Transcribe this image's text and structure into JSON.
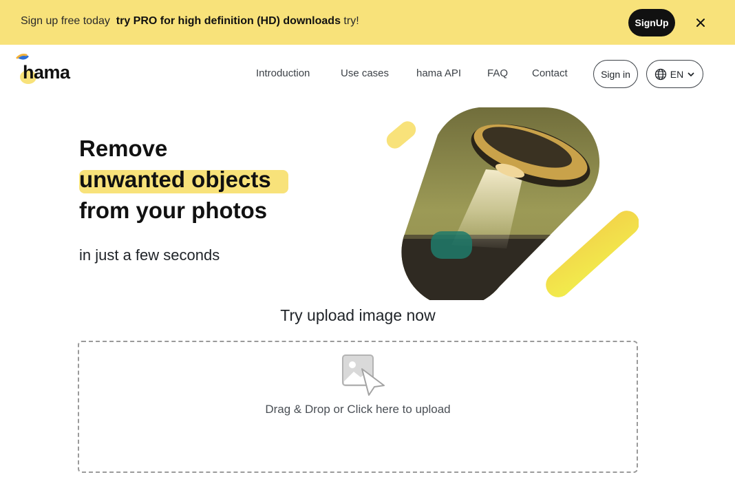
{
  "promo": {
    "text_before": "Sign up free today",
    "text_bold": "try PRO for high definition (HD) downloads",
    "text_after": "try!",
    "signup_label": "SignUp"
  },
  "header": {
    "logo_text": "hama",
    "nav": [
      "Introduction",
      "Use cases",
      "hama API",
      "FAQ",
      "Contact"
    ],
    "signin_label": "Sign in",
    "language": "EN"
  },
  "hero": {
    "line1": "Remove",
    "line2": "unwanted objects",
    "line3": "from your photos",
    "subtitle": "in just a few seconds"
  },
  "upload": {
    "heading": "Try upload image now",
    "dropzone_text": "Drag & Drop or Click here to upload"
  },
  "colors": {
    "accent_yellow": "#f8e27a",
    "dark": "#111111"
  }
}
